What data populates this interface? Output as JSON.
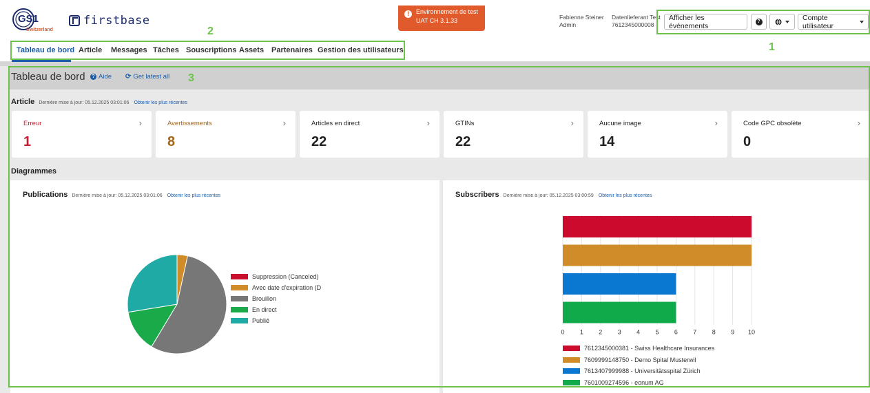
{
  "brand": {
    "gs1_text": "GS1",
    "gs1_country": "Switzerland",
    "product": "firstbase"
  },
  "env": {
    "line1": "Environnement de test",
    "line2": "UAT CH 3.1.33"
  },
  "user": {
    "name": "Fabienne Steiner",
    "role": "Admin",
    "company": "Datenlieferant Test",
    "gln": "7612345000008"
  },
  "header_buttons": {
    "events": "Afficher les événements",
    "account": "Compte utilisateur"
  },
  "nav": {
    "items": [
      "Tableau de bord",
      "Article",
      "Messages",
      "Tâches",
      "Souscriptions",
      "Assets",
      "Partenaires",
      "Gestion des utilisateurs"
    ]
  },
  "dashboard": {
    "title": "Tableau de bord",
    "help": "Aide",
    "latest": "Get latest all"
  },
  "article": {
    "heading": "Article",
    "updated": "Dernière mise à jour: 05.12.2025 03:01:06",
    "refresh": "Obtenir les plus récentes",
    "cards": [
      {
        "label": "Erreur",
        "value": "1"
      },
      {
        "label": "Avertissements",
        "value": "8"
      },
      {
        "label": "Articles en direct",
        "value": "22"
      },
      {
        "label": "GTINs",
        "value": "22"
      },
      {
        "label": "Aucune image",
        "value": "14"
      },
      {
        "label": "Code GPC obsolète",
        "value": "0"
      }
    ]
  },
  "diagrams": {
    "heading": "Diagrammes"
  },
  "publications": {
    "title": "Publications",
    "updated": "Dernière mise à jour: 05.12.2025 03:01:06",
    "refresh": "Obtenir les plus récentes"
  },
  "subscribers": {
    "title": "Subscribers",
    "updated": "Dernière mise à jour: 05.12.2025 03:00:59",
    "refresh": "Obtenir les plus récentes"
  },
  "annotations": [
    "1",
    "2",
    "3"
  ],
  "colors": {
    "accent": "#1a5ca8",
    "error": "#c81e32",
    "warning": "#a1651c",
    "annotation": "#6cc24a",
    "env_badge": "#e05a2b"
  },
  "chart_data": [
    {
      "type": "pie",
      "title": "",
      "labels": [
        "Suppression (Canceled)",
        "Avec date d'expiration (D",
        "Brouillon",
        "En direct",
        "Publié"
      ],
      "values": [
        0,
        1,
        16,
        4,
        8
      ],
      "colors": [
        "#c8102e",
        "#d08c28",
        "#777777",
        "#1aaa4a",
        "#20aaa6"
      ]
    },
    {
      "type": "bar",
      "orientation": "horizontal",
      "title": "",
      "categories": [
        "7612345000381 - Swiss Healthcare Insurances",
        "7609999148750 - Demo Spital Musterwil",
        "7613407999988 - Universitätsspital Zürich",
        "7601009274596 - eonum AG"
      ],
      "values": [
        10,
        10,
        6,
        6
      ],
      "colors": [
        "#cc0a2e",
        "#d08c28",
        "#0a78d0",
        "#10aa4a"
      ],
      "xlim": [
        0,
        10
      ],
      "xticks": [
        "0",
        "1",
        "2",
        "3",
        "4",
        "5",
        "6",
        "7",
        "8",
        "9",
        "10"
      ],
      "grid": true,
      "legend": "bottom"
    }
  ]
}
